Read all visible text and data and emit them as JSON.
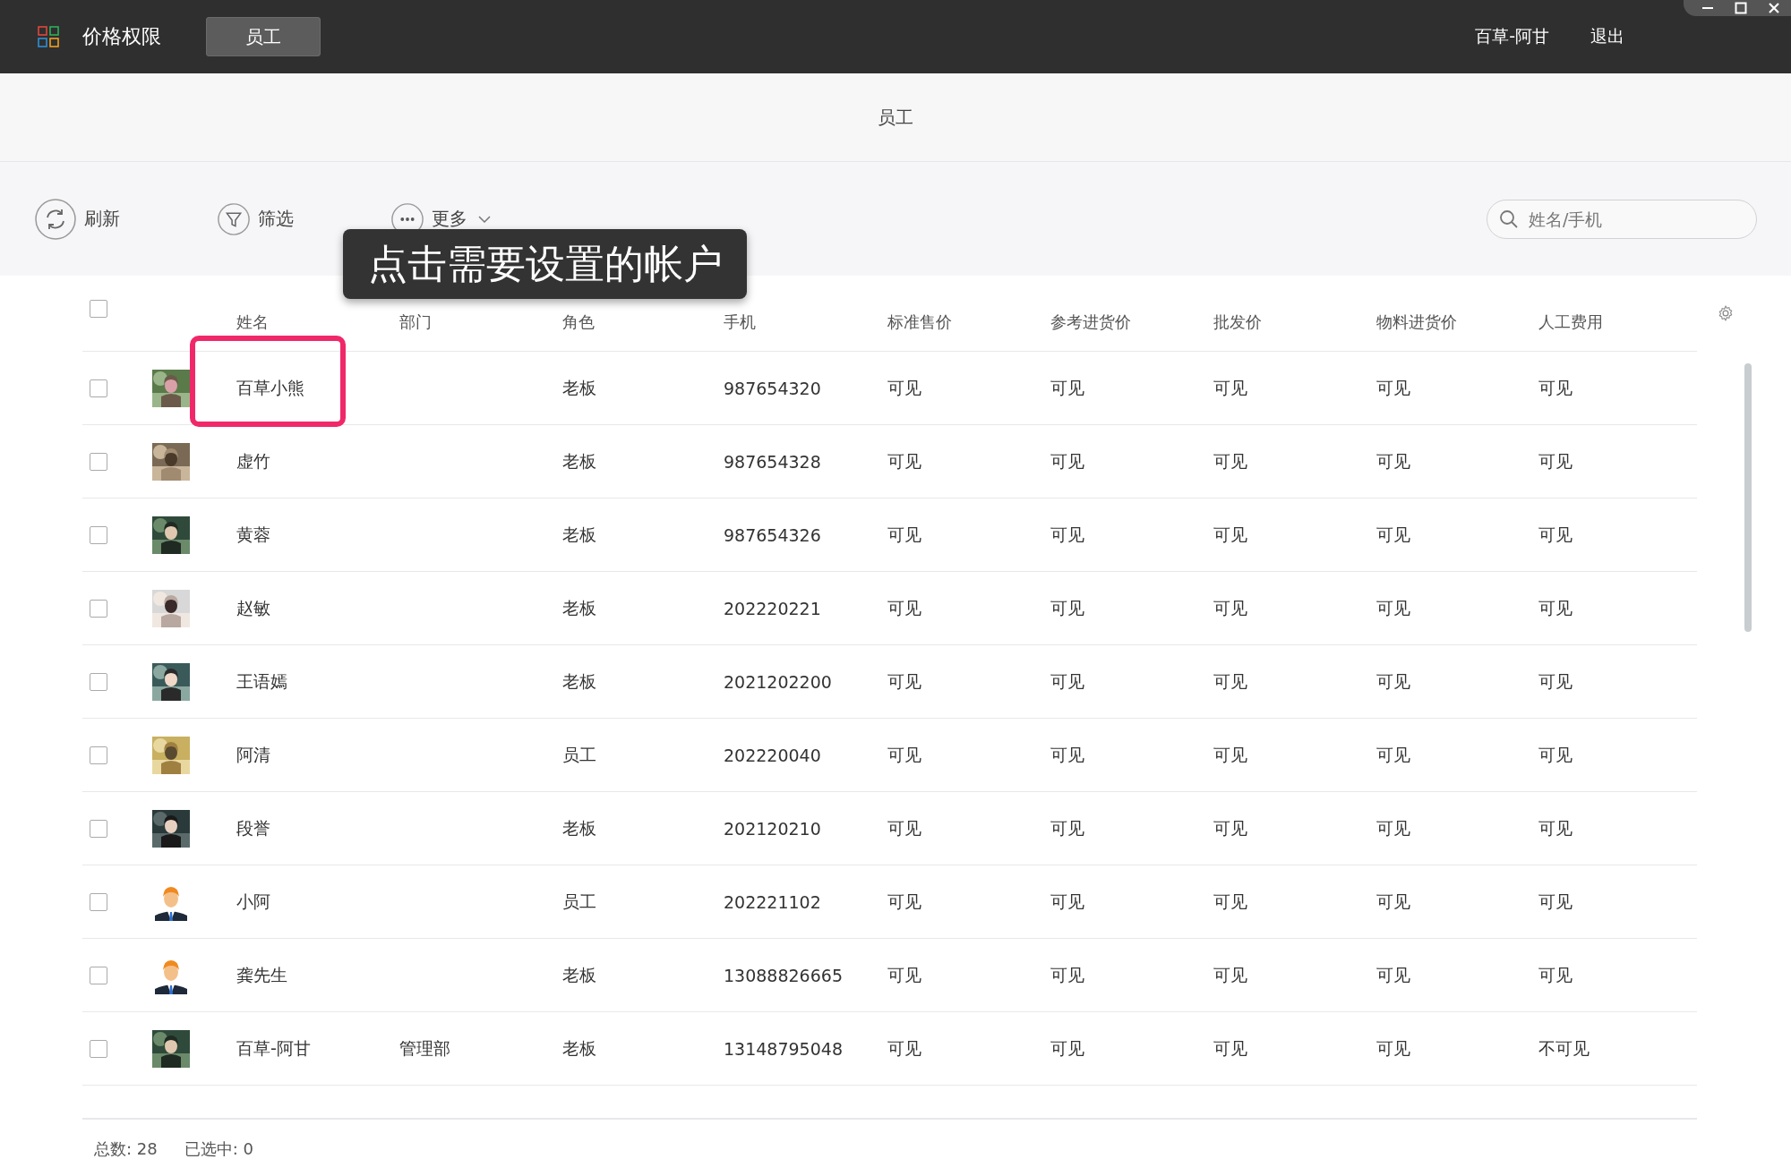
{
  "app_bar": {
    "title": "价格权限",
    "tabs": [
      {
        "label": "员工",
        "selected": true
      }
    ],
    "user": "百草-阿甘",
    "logout": "退出"
  },
  "page_title": "员工",
  "toolbar": {
    "refresh": "刷新",
    "filter": "筛选",
    "more": "更多",
    "search": {
      "placeholder": "姓名/手机"
    }
  },
  "callout": "点击需要设置的帐户",
  "table": {
    "select_all": {
      "checked": false
    },
    "columns": [
      "姓名",
      "部门",
      "角色",
      "手机",
      "标准售价",
      "参考进货价",
      "批发价",
      "物料进货价",
      "人工费用"
    ],
    "rows": [
      {
        "checked": false,
        "highlighted": true,
        "avatar": {
          "kind": "picture"
        },
        "cells": [
          "百草小熊",
          "",
          "老板",
          "987654320",
          "可见",
          "可见",
          "可见",
          "可见",
          "可见"
        ]
      },
      {
        "checked": false,
        "highlighted": false,
        "avatar": {
          "kind": "picture"
        },
        "cells": [
          "虚竹",
          "",
          "老板",
          "987654328",
          "可见",
          "可见",
          "可见",
          "可见",
          "可见"
        ]
      },
      {
        "checked": false,
        "highlighted": false,
        "avatar": {
          "kind": "picture"
        },
        "cells": [
          "黄蓉",
          "",
          "老板",
          "987654326",
          "可见",
          "可见",
          "可见",
          "可见",
          "可见"
        ]
      },
      {
        "checked": false,
        "highlighted": false,
        "avatar": {
          "kind": "picture"
        },
        "cells": [
          "赵敏",
          "",
          "老板",
          "202220221",
          "可见",
          "可见",
          "可见",
          "可见",
          "可见"
        ]
      },
      {
        "checked": false,
        "highlighted": false,
        "avatar": {
          "kind": "picture"
        },
        "cells": [
          "王语嫣",
          "",
          "老板",
          "2021202200",
          "可见",
          "可见",
          "可见",
          "可见",
          "可见"
        ]
      },
      {
        "checked": false,
        "highlighted": false,
        "avatar": {
          "kind": "picture"
        },
        "cells": [
          "阿清",
          "",
          "员工",
          "202220040",
          "可见",
          "可见",
          "可见",
          "可见",
          "可见"
        ]
      },
      {
        "checked": false,
        "highlighted": false,
        "avatar": {
          "kind": "picture"
        },
        "cells": [
          "段誉",
          "",
          "老板",
          "202120210",
          "可见",
          "可见",
          "可见",
          "可见",
          "可见"
        ]
      },
      {
        "checked": false,
        "highlighted": false,
        "avatar": {
          "kind": "figure"
        },
        "cells": [
          "小阿",
          "",
          "员工",
          "202221102",
          "可见",
          "可见",
          "可见",
          "可见",
          "可见"
        ]
      },
      {
        "checked": false,
        "highlighted": false,
        "avatar": {
          "kind": "figure"
        },
        "cells": [
          "龚先生",
          "",
          "老板",
          "13088826665",
          "可见",
          "可见",
          "可见",
          "可见",
          "可见"
        ]
      },
      {
        "checked": false,
        "highlighted": false,
        "avatar": {
          "kind": "picture"
        },
        "cells": [
          "百草-阿甘",
          "管理部",
          "老板",
          "13148795048",
          "可见",
          "可见",
          "可见",
          "可见",
          "不可见"
        ]
      }
    ]
  },
  "footer": {
    "total_label": "总数:",
    "total": "28",
    "selected_label": "已选中:",
    "selected": "0"
  }
}
